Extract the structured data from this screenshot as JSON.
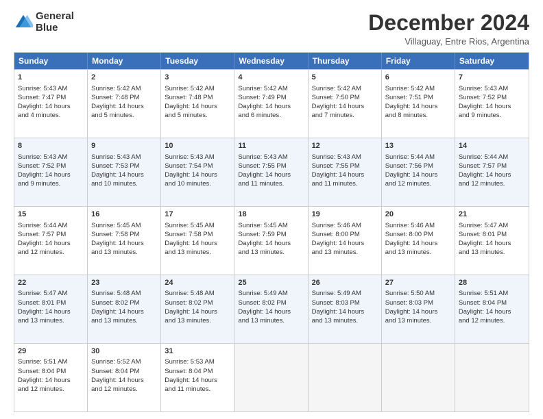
{
  "logo": {
    "line1": "General",
    "line2": "Blue"
  },
  "title": "December 2024",
  "subtitle": "Villaguay, Entre Rios, Argentina",
  "days": [
    "Sunday",
    "Monday",
    "Tuesday",
    "Wednesday",
    "Thursday",
    "Friday",
    "Saturday"
  ],
  "weeks": [
    [
      {
        "day": 1,
        "lines": [
          "Sunrise: 5:43 AM",
          "Sunset: 7:47 PM",
          "Daylight: 14 hours",
          "and 4 minutes."
        ]
      },
      {
        "day": 2,
        "lines": [
          "Sunrise: 5:42 AM",
          "Sunset: 7:48 PM",
          "Daylight: 14 hours",
          "and 5 minutes."
        ]
      },
      {
        "day": 3,
        "lines": [
          "Sunrise: 5:42 AM",
          "Sunset: 7:48 PM",
          "Daylight: 14 hours",
          "and 5 minutes."
        ]
      },
      {
        "day": 4,
        "lines": [
          "Sunrise: 5:42 AM",
          "Sunset: 7:49 PM",
          "Daylight: 14 hours",
          "and 6 minutes."
        ]
      },
      {
        "day": 5,
        "lines": [
          "Sunrise: 5:42 AM",
          "Sunset: 7:50 PM",
          "Daylight: 14 hours",
          "and 7 minutes."
        ]
      },
      {
        "day": 6,
        "lines": [
          "Sunrise: 5:42 AM",
          "Sunset: 7:51 PM",
          "Daylight: 14 hours",
          "and 8 minutes."
        ]
      },
      {
        "day": 7,
        "lines": [
          "Sunrise: 5:43 AM",
          "Sunset: 7:52 PM",
          "Daylight: 14 hours",
          "and 9 minutes."
        ]
      }
    ],
    [
      {
        "day": 8,
        "lines": [
          "Sunrise: 5:43 AM",
          "Sunset: 7:52 PM",
          "Daylight: 14 hours",
          "and 9 minutes."
        ]
      },
      {
        "day": 9,
        "lines": [
          "Sunrise: 5:43 AM",
          "Sunset: 7:53 PM",
          "Daylight: 14 hours",
          "and 10 minutes."
        ]
      },
      {
        "day": 10,
        "lines": [
          "Sunrise: 5:43 AM",
          "Sunset: 7:54 PM",
          "Daylight: 14 hours",
          "and 10 minutes."
        ]
      },
      {
        "day": 11,
        "lines": [
          "Sunrise: 5:43 AM",
          "Sunset: 7:55 PM",
          "Daylight: 14 hours",
          "and 11 minutes."
        ]
      },
      {
        "day": 12,
        "lines": [
          "Sunrise: 5:43 AM",
          "Sunset: 7:55 PM",
          "Daylight: 14 hours",
          "and 11 minutes."
        ]
      },
      {
        "day": 13,
        "lines": [
          "Sunrise: 5:44 AM",
          "Sunset: 7:56 PM",
          "Daylight: 14 hours",
          "and 12 minutes."
        ]
      },
      {
        "day": 14,
        "lines": [
          "Sunrise: 5:44 AM",
          "Sunset: 7:57 PM",
          "Daylight: 14 hours",
          "and 12 minutes."
        ]
      }
    ],
    [
      {
        "day": 15,
        "lines": [
          "Sunrise: 5:44 AM",
          "Sunset: 7:57 PM",
          "Daylight: 14 hours",
          "and 12 minutes."
        ]
      },
      {
        "day": 16,
        "lines": [
          "Sunrise: 5:45 AM",
          "Sunset: 7:58 PM",
          "Daylight: 14 hours",
          "and 13 minutes."
        ]
      },
      {
        "day": 17,
        "lines": [
          "Sunrise: 5:45 AM",
          "Sunset: 7:58 PM",
          "Daylight: 14 hours",
          "and 13 minutes."
        ]
      },
      {
        "day": 18,
        "lines": [
          "Sunrise: 5:45 AM",
          "Sunset: 7:59 PM",
          "Daylight: 14 hours",
          "and 13 minutes."
        ]
      },
      {
        "day": 19,
        "lines": [
          "Sunrise: 5:46 AM",
          "Sunset: 8:00 PM",
          "Daylight: 14 hours",
          "and 13 minutes."
        ]
      },
      {
        "day": 20,
        "lines": [
          "Sunrise: 5:46 AM",
          "Sunset: 8:00 PM",
          "Daylight: 14 hours",
          "and 13 minutes."
        ]
      },
      {
        "day": 21,
        "lines": [
          "Sunrise: 5:47 AM",
          "Sunset: 8:01 PM",
          "Daylight: 14 hours",
          "and 13 minutes."
        ]
      }
    ],
    [
      {
        "day": 22,
        "lines": [
          "Sunrise: 5:47 AM",
          "Sunset: 8:01 PM",
          "Daylight: 14 hours",
          "and 13 minutes."
        ]
      },
      {
        "day": 23,
        "lines": [
          "Sunrise: 5:48 AM",
          "Sunset: 8:02 PM",
          "Daylight: 14 hours",
          "and 13 minutes."
        ]
      },
      {
        "day": 24,
        "lines": [
          "Sunrise: 5:48 AM",
          "Sunset: 8:02 PM",
          "Daylight: 14 hours",
          "and 13 minutes."
        ]
      },
      {
        "day": 25,
        "lines": [
          "Sunrise: 5:49 AM",
          "Sunset: 8:02 PM",
          "Daylight: 14 hours",
          "and 13 minutes."
        ]
      },
      {
        "day": 26,
        "lines": [
          "Sunrise: 5:49 AM",
          "Sunset: 8:03 PM",
          "Daylight: 14 hours",
          "and 13 minutes."
        ]
      },
      {
        "day": 27,
        "lines": [
          "Sunrise: 5:50 AM",
          "Sunset: 8:03 PM",
          "Daylight: 14 hours",
          "and 13 minutes."
        ]
      },
      {
        "day": 28,
        "lines": [
          "Sunrise: 5:51 AM",
          "Sunset: 8:04 PM",
          "Daylight: 14 hours",
          "and 12 minutes."
        ]
      }
    ],
    [
      {
        "day": 29,
        "lines": [
          "Sunrise: 5:51 AM",
          "Sunset: 8:04 PM",
          "Daylight: 14 hours",
          "and 12 minutes."
        ]
      },
      {
        "day": 30,
        "lines": [
          "Sunrise: 5:52 AM",
          "Sunset: 8:04 PM",
          "Daylight: 14 hours",
          "and 12 minutes."
        ]
      },
      {
        "day": 31,
        "lines": [
          "Sunrise: 5:53 AM",
          "Sunset: 8:04 PM",
          "Daylight: 14 hours",
          "and 11 minutes."
        ]
      },
      null,
      null,
      null,
      null
    ]
  ]
}
